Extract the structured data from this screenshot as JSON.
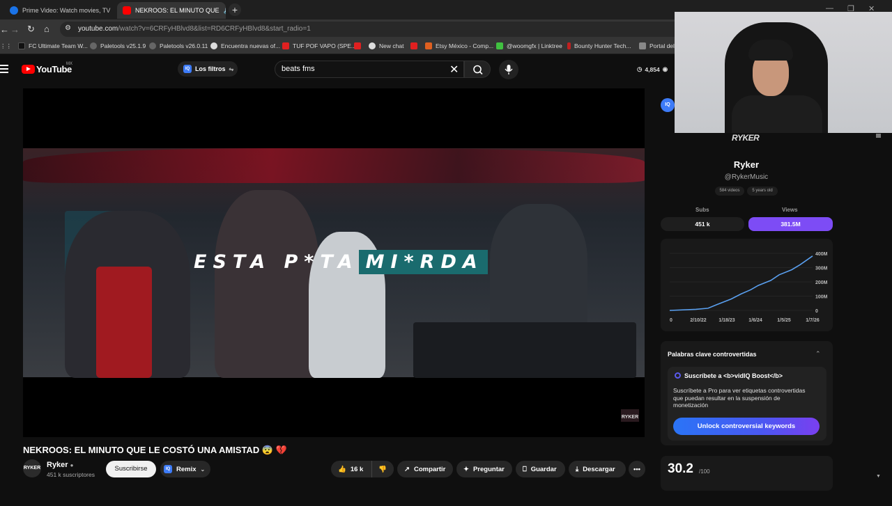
{
  "browser": {
    "tabs": [
      {
        "title": "Prime Video: Watch movies, TV",
        "close": "✕"
      },
      {
        "title": "NEKROOS: EL MINUTO QUE",
        "close": "✕"
      }
    ],
    "new_tab": "+",
    "url_host": "youtube.com",
    "url_path": "/watch?v=6CRFyHBlvd8&list=RD6CRFyHBlvd8&start_radio=1",
    "bookmarks": [
      {
        "label": "FC Ultimate Team W...",
        "color": "#1a1a1a"
      },
      {
        "label": "Paletools v25.1.9",
        "color": "#666666"
      },
      {
        "label": "Paletools v26.0.11",
        "color": "#666666"
      },
      {
        "label": "Encuentra nuevas of...",
        "color": "#dddddd"
      },
      {
        "label": "TUF POF VAPO (SPE...",
        "color": "#e02020"
      },
      {
        "label": "New chat",
        "color": "#e02020"
      },
      {
        "label": "Etsy México - Comp...",
        "color": "#e06020"
      },
      {
        "label": "@woomgfx | Linktree",
        "color": "#40c040"
      },
      {
        "label": "Bounty Hunter Tech...",
        "color": "#c02020"
      },
      {
        "label": "Portal del C",
        "color": "#888888"
      }
    ]
  },
  "youtube": {
    "logo": "YouTube",
    "country": "MX",
    "filters_label": "Los filtros",
    "search_value": "beats fms",
    "counter": "4,854"
  },
  "video": {
    "caption_a": "ESTA P*TA",
    "caption_b": "MI*RDA",
    "watermark": "RYKER",
    "title": "NEKROOS: EL MINUTO QUE LE COSTÓ UNA AMISTAD 😨 💔",
    "channel": "Ryker",
    "avatar_text": "RYKER",
    "subscribers": "451 k suscriptores",
    "subscribe_label": "Suscribirse",
    "remix_label": "Remix",
    "likes": "16 k",
    "share_label": "Compartir",
    "ask_label": "Preguntar",
    "save_label": "Guardar",
    "download_label": "Descargar"
  },
  "panel": {
    "iq_badge": "IQ",
    "logo_text": "RYKER",
    "name": "Ryker",
    "handle": "@RykerMusic",
    "videos": "584 videos",
    "age": "5 years old",
    "subs_label": "Subs",
    "subs_value": "451 k",
    "views_label": "Views",
    "views_value": "381.5M",
    "kw_title": "Palabras clave controvertidas",
    "kw_subscribe": "Suscríbete a <b>vidIQ Boost</b>",
    "kw_desc": "Suscríbete a Pro para ver etiquetas controvertidas que puedan resultar en la suspensión de monetización",
    "kw_button": "Unlock controversial keywords",
    "score": "30.2",
    "score_max": "/100"
  },
  "chart_data": {
    "type": "line",
    "x": [
      "2019-03-01",
      "2020-06-01",
      "2021-01-01",
      "2021-06-01",
      "2022-02-10",
      "2022-08-01",
      "2023-01-18",
      "2023-06-01",
      "2024-01-06",
      "2024-06-01",
      "2025-01-05",
      "2025-06-01",
      "2026-01-07"
    ],
    "series": [
      {
        "values": [
          0,
          8,
          15,
          40,
          80,
          115,
          145,
          175,
          210,
          250,
          285,
          320,
          381.5
        ]
      }
    ],
    "x_ticks": [
      "0",
      "2/10/22",
      "1/18/23",
      "1/6/24",
      "1/5/25",
      "1/7/26"
    ],
    "y_ticks": [
      "0",
      "100M",
      "200M",
      "300M",
      "400M"
    ],
    "ylim": [
      0,
      400
    ],
    "grid": true,
    "color": "#5aa0f0"
  }
}
